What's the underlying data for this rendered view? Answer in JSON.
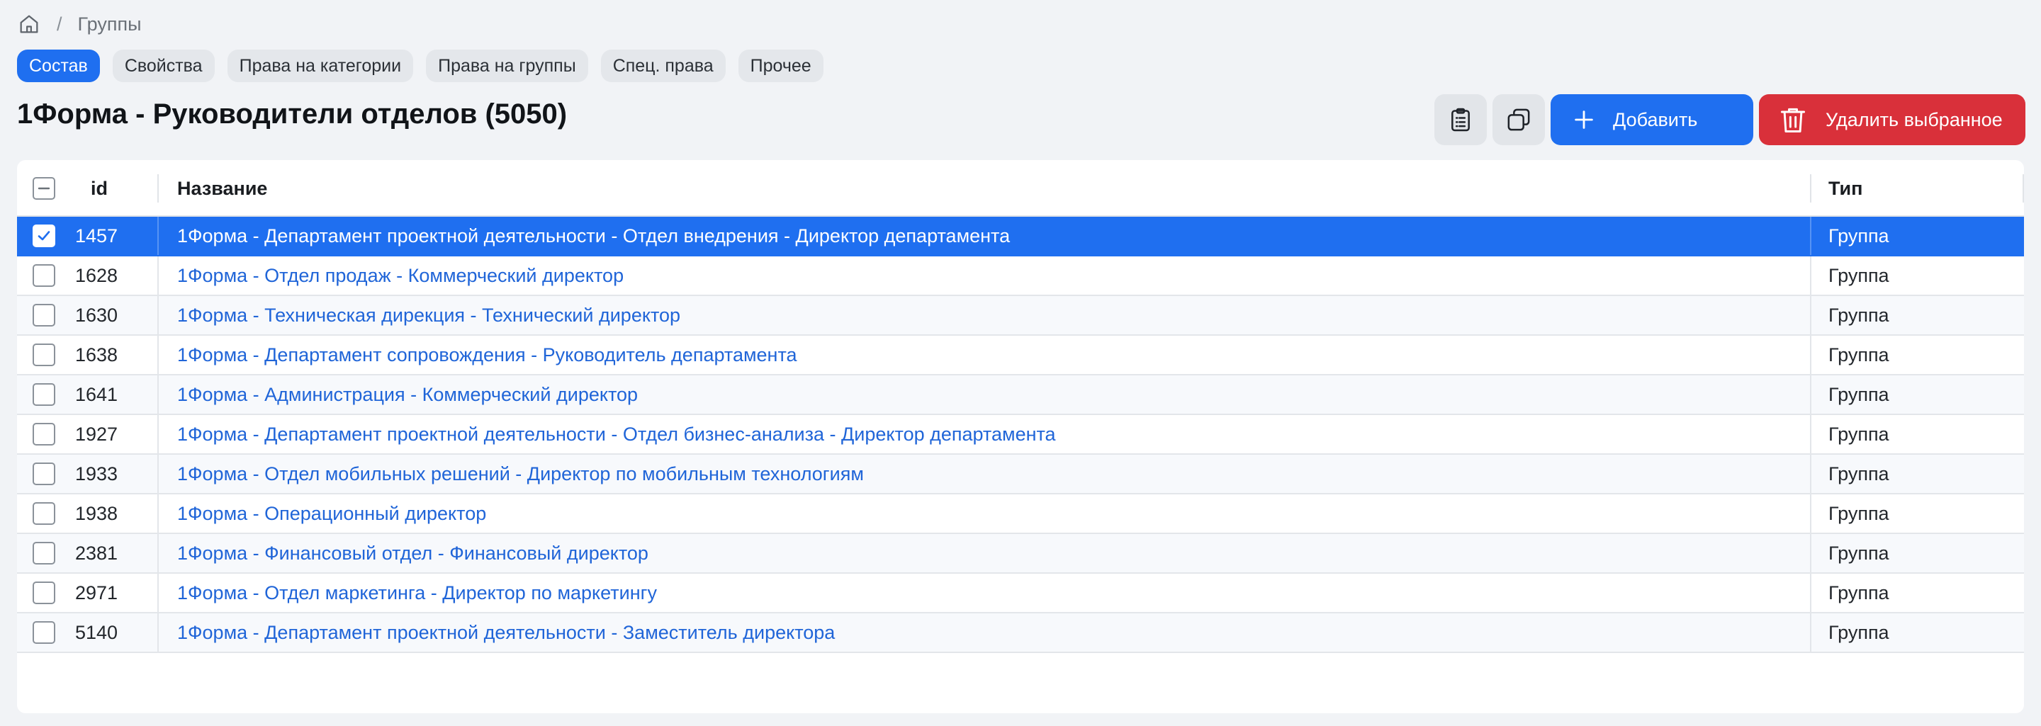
{
  "breadcrumb": {
    "home_icon": "home-icon",
    "separator": "/",
    "current": "Группы"
  },
  "tabs": [
    {
      "label": "Состав",
      "active": true
    },
    {
      "label": "Свойства",
      "active": false
    },
    {
      "label": "Права на категории",
      "active": false
    },
    {
      "label": "Права на группы",
      "active": false
    },
    {
      "label": "Спец. права",
      "active": false
    },
    {
      "label": "Прочее",
      "active": false
    }
  ],
  "title": "1Форма - Руководители отделов (5050)",
  "toolbar": {
    "clipboard_icon": "clipboard-list-icon",
    "copy_icon": "copy-icon",
    "add_label": "Добавить",
    "delete_label": "Удалить выбранное"
  },
  "table": {
    "columns": {
      "id": "id",
      "name": "Название",
      "type": "Тип"
    },
    "rows": [
      {
        "id": "1457",
        "name": "1Форма - Департамент проектной деятельности - Отдел внедрения - Директор департамента",
        "type": "Группа",
        "checked": true
      },
      {
        "id": "1628",
        "name": "1Форма - Отдел продаж - Коммерческий директор",
        "type": "Группа",
        "checked": false
      },
      {
        "id": "1630",
        "name": "1Форма - Техническая дирекция - Технический директор",
        "type": "Группа",
        "checked": false
      },
      {
        "id": "1638",
        "name": "1Форма - Департамент сопровождения - Руководитель департамента",
        "type": "Группа",
        "checked": false
      },
      {
        "id": "1641",
        "name": "1Форма - Администрация - Коммерческий директор",
        "type": "Группа",
        "checked": false
      },
      {
        "id": "1927",
        "name": "1Форма - Департамент проектной деятельности - Отдел бизнес-анализа - Директор департамента",
        "type": "Группа",
        "checked": false
      },
      {
        "id": "1933",
        "name": "1Форма - Отдел мобильных решений - Директор по мобильным технологиям",
        "type": "Группа",
        "checked": false
      },
      {
        "id": "1938",
        "name": "1Форма - Операционный директор",
        "type": "Группа",
        "checked": false
      },
      {
        "id": "2381",
        "name": "1Форма - Финансовый отдел - Финансовый директор",
        "type": "Группа",
        "checked": false
      },
      {
        "id": "2971",
        "name": "1Форма - Отдел маркетинга - Директор по маркетингу",
        "type": "Группа",
        "checked": false
      },
      {
        "id": "5140",
        "name": "1Форма - Департамент проектной деятельности - Заместитель директора",
        "type": "Группа",
        "checked": false
      }
    ]
  },
  "colors": {
    "accent": "#1f6ff0",
    "danger": "#d9303a",
    "link": "#2065d8",
    "background": "#f1f3f6"
  }
}
